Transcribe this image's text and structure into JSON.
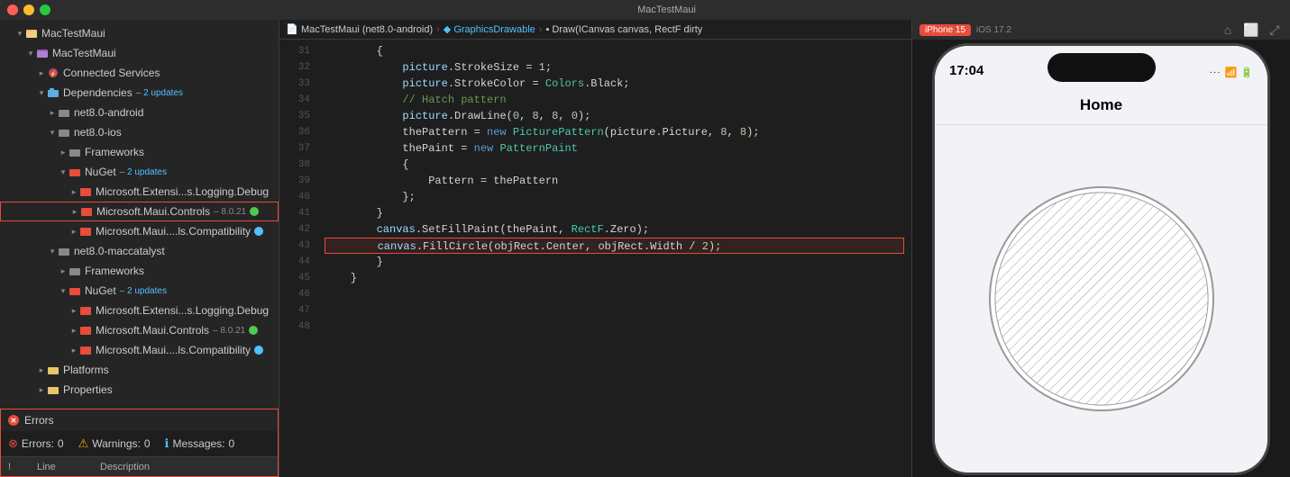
{
  "titleBar": {
    "windowTitle": "MacTestMaui",
    "breadcrumb": "MacTestMaui (net8.0-android) › GraphicsDrawable › Draw(ICanvas canvas, RectF dirty"
  },
  "sidebar": {
    "rootItem": "MacTestMaui",
    "tree": [
      {
        "id": "root",
        "label": "MacTestMaui",
        "level": 0,
        "type": "solution",
        "expanded": true
      },
      {
        "id": "project",
        "label": "MacTestMaui",
        "level": 1,
        "type": "project",
        "expanded": true
      },
      {
        "id": "connected-services",
        "label": "Connected Services",
        "level": 2,
        "type": "connected-services"
      },
      {
        "id": "dependencies",
        "label": "Dependencies",
        "level": 2,
        "type": "folder",
        "expanded": true,
        "badge": "– 2 updates"
      },
      {
        "id": "net80-android",
        "label": "net8.0-android",
        "level": 3,
        "type": "folder",
        "expanded": false
      },
      {
        "id": "net80-ios",
        "label": "net8.0-ios",
        "level": 3,
        "type": "folder",
        "expanded": true
      },
      {
        "id": "frameworks-ios",
        "label": "Frameworks",
        "level": 4,
        "type": "folder",
        "expanded": false
      },
      {
        "id": "nuget-ios",
        "label": "NuGet",
        "level": 4,
        "type": "nuget",
        "expanded": true,
        "badge": "– 2 updates"
      },
      {
        "id": "logging-debug-ios",
        "label": "Microsoft.Extensi...s.Logging.Debug",
        "level": 5,
        "type": "package"
      },
      {
        "id": "maui-controls-ios",
        "label": "Microsoft.Maui.Controls",
        "level": 5,
        "type": "package",
        "version": "– 8.0.21",
        "highlight": true,
        "indicator": "green"
      },
      {
        "id": "maui-compat-ios",
        "label": "Microsoft.Maui....ls.Compatibility",
        "level": 5,
        "type": "package",
        "indicator": "blue"
      },
      {
        "id": "net80-maccatalyst",
        "label": "net8.0-maccatalyst",
        "level": 3,
        "type": "folder",
        "expanded": true
      },
      {
        "id": "frameworks-mac",
        "label": "Frameworks",
        "level": 4,
        "type": "folder",
        "expanded": false
      },
      {
        "id": "nuget-mac",
        "label": "NuGet",
        "level": 4,
        "type": "nuget",
        "expanded": true,
        "badge": "– 2 updates"
      },
      {
        "id": "logging-debug-mac",
        "label": "Microsoft.Extensi...s.Logging.Debug",
        "level": 5,
        "type": "package"
      },
      {
        "id": "maui-controls-mac",
        "label": "Microsoft.Maui.Controls",
        "level": 5,
        "type": "package",
        "version": "– 8.0.21",
        "indicator": "green"
      },
      {
        "id": "maui-compat-mac",
        "label": "Microsoft.Maui....ls.Compatibility",
        "level": 5,
        "type": "package",
        "indicator": "blue"
      },
      {
        "id": "platforms",
        "label": "Platforms",
        "level": 2,
        "type": "folder",
        "expanded": false
      },
      {
        "id": "properties",
        "label": "Properties",
        "level": 2,
        "type": "folder",
        "expanded": false
      }
    ]
  },
  "codeEditor": {
    "lines": [
      {
        "num": 31,
        "code": "        {"
      },
      {
        "num": 32,
        "code": "            picture.StrokeSize = 1;"
      },
      {
        "num": 33,
        "code": "            picture.StrokeColor = Colors.Black;"
      },
      {
        "num": 34,
        "code": "            // Hatch pattern"
      },
      {
        "num": 35,
        "code": "            picture.DrawLine(0, 8, 8, 0);"
      },
      {
        "num": 36,
        "code": "            thePattern = new PicturePattern(picture.Picture, 8, 8);"
      },
      {
        "num": 37,
        "code": "            thePaint = new PatternPaint"
      },
      {
        "num": 38,
        "code": "            {"
      },
      {
        "num": 39,
        "code": "                Pattern = thePattern"
      },
      {
        "num": 40,
        "code": "            };"
      },
      {
        "num": 41,
        "code": "        }"
      },
      {
        "num": 42,
        "code": "        canvas.SetFillPaint(thePaint, RectF.Zero);"
      },
      {
        "num": 43,
        "code": "        canvas.FillCircle(objRect.Center, objRect.Width / 2);",
        "highlight": true
      },
      {
        "num": 44,
        "code": "        }"
      },
      {
        "num": 45,
        "code": "    }"
      },
      {
        "num": 46,
        "code": ""
      },
      {
        "num": 47,
        "code": ""
      },
      {
        "num": 48,
        "code": ""
      }
    ]
  },
  "errorPanel": {
    "title": "Errors",
    "errorsCount": "0",
    "warningsCount": "0",
    "messagesCount": "0",
    "errorsLabel": "Errors:",
    "warningsLabel": "Warnings:",
    "messagesLabel": "Messages:",
    "tableHeaders": {
      "exclaim": "!",
      "line": "Line",
      "description": "Description"
    }
  },
  "simulator": {
    "deviceName": "iPhone 15",
    "iosVersion": "iOS 17.2",
    "statusTime": "17:04",
    "navTitle": "Home"
  }
}
